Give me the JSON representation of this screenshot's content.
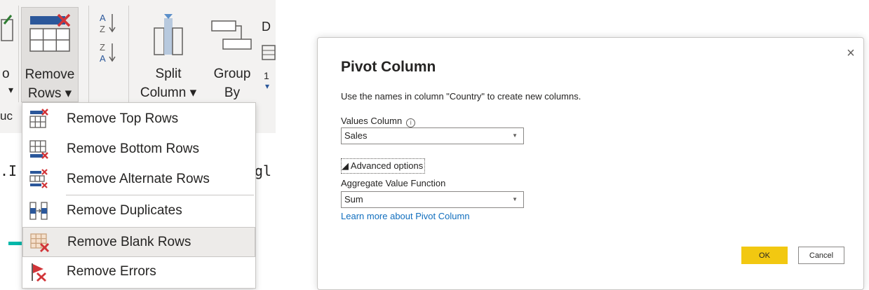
{
  "ribbon": {
    "remove_rows": {
      "line1": "Remove",
      "line2": "Rows ▾"
    },
    "split_column": {
      "line1": "Split",
      "line2": "Column ▾"
    },
    "group_by": {
      "line1": "Group",
      "line2": "By"
    },
    "partial_left": {
      "label_o": "o",
      "label_dropdown": "▾",
      "label_uc": "uc"
    },
    "partial_right": {
      "letter": "D",
      "digit": "1",
      "chevron": "▾"
    }
  },
  "formula_bar": {
    "left_text": ".I",
    "right_text": "gl"
  },
  "remove_rows_menu": {
    "items": [
      {
        "label": "Remove Top Rows",
        "icon": "remove-top-rows-icon"
      },
      {
        "label": "Remove Bottom Rows",
        "icon": "remove-bottom-rows-icon"
      },
      {
        "label": "Remove Alternate Rows",
        "icon": "remove-alternate-rows-icon"
      },
      {
        "label": "Remove Duplicates",
        "icon": "remove-duplicates-icon"
      },
      {
        "label": "Remove Blank Rows",
        "icon": "remove-blank-rows-icon",
        "hovered": true
      },
      {
        "label": "Remove Errors",
        "icon": "remove-errors-icon"
      }
    ]
  },
  "dialog": {
    "title": "Pivot Column",
    "description": "Use the names in column \"Country\" to create new columns.",
    "values_column_label": "Values Column",
    "info_glyph": "i",
    "values_column_value": "Sales",
    "advanced_options_label": "◢ Advanced options",
    "aggregate_label": "Aggregate Value Function",
    "aggregate_value": "Sum",
    "learn_more_link": "Learn more about Pivot Column",
    "ok_label": "OK",
    "cancel_label": "Cancel",
    "close_glyph": "×",
    "chevron_glyph": "▼"
  },
  "colors": {
    "accent_yellow": "#f2c811",
    "link_blue": "#106ebe",
    "icon_blue": "#2b579a",
    "icon_red": "#d13438",
    "teal": "#01b8aa"
  }
}
